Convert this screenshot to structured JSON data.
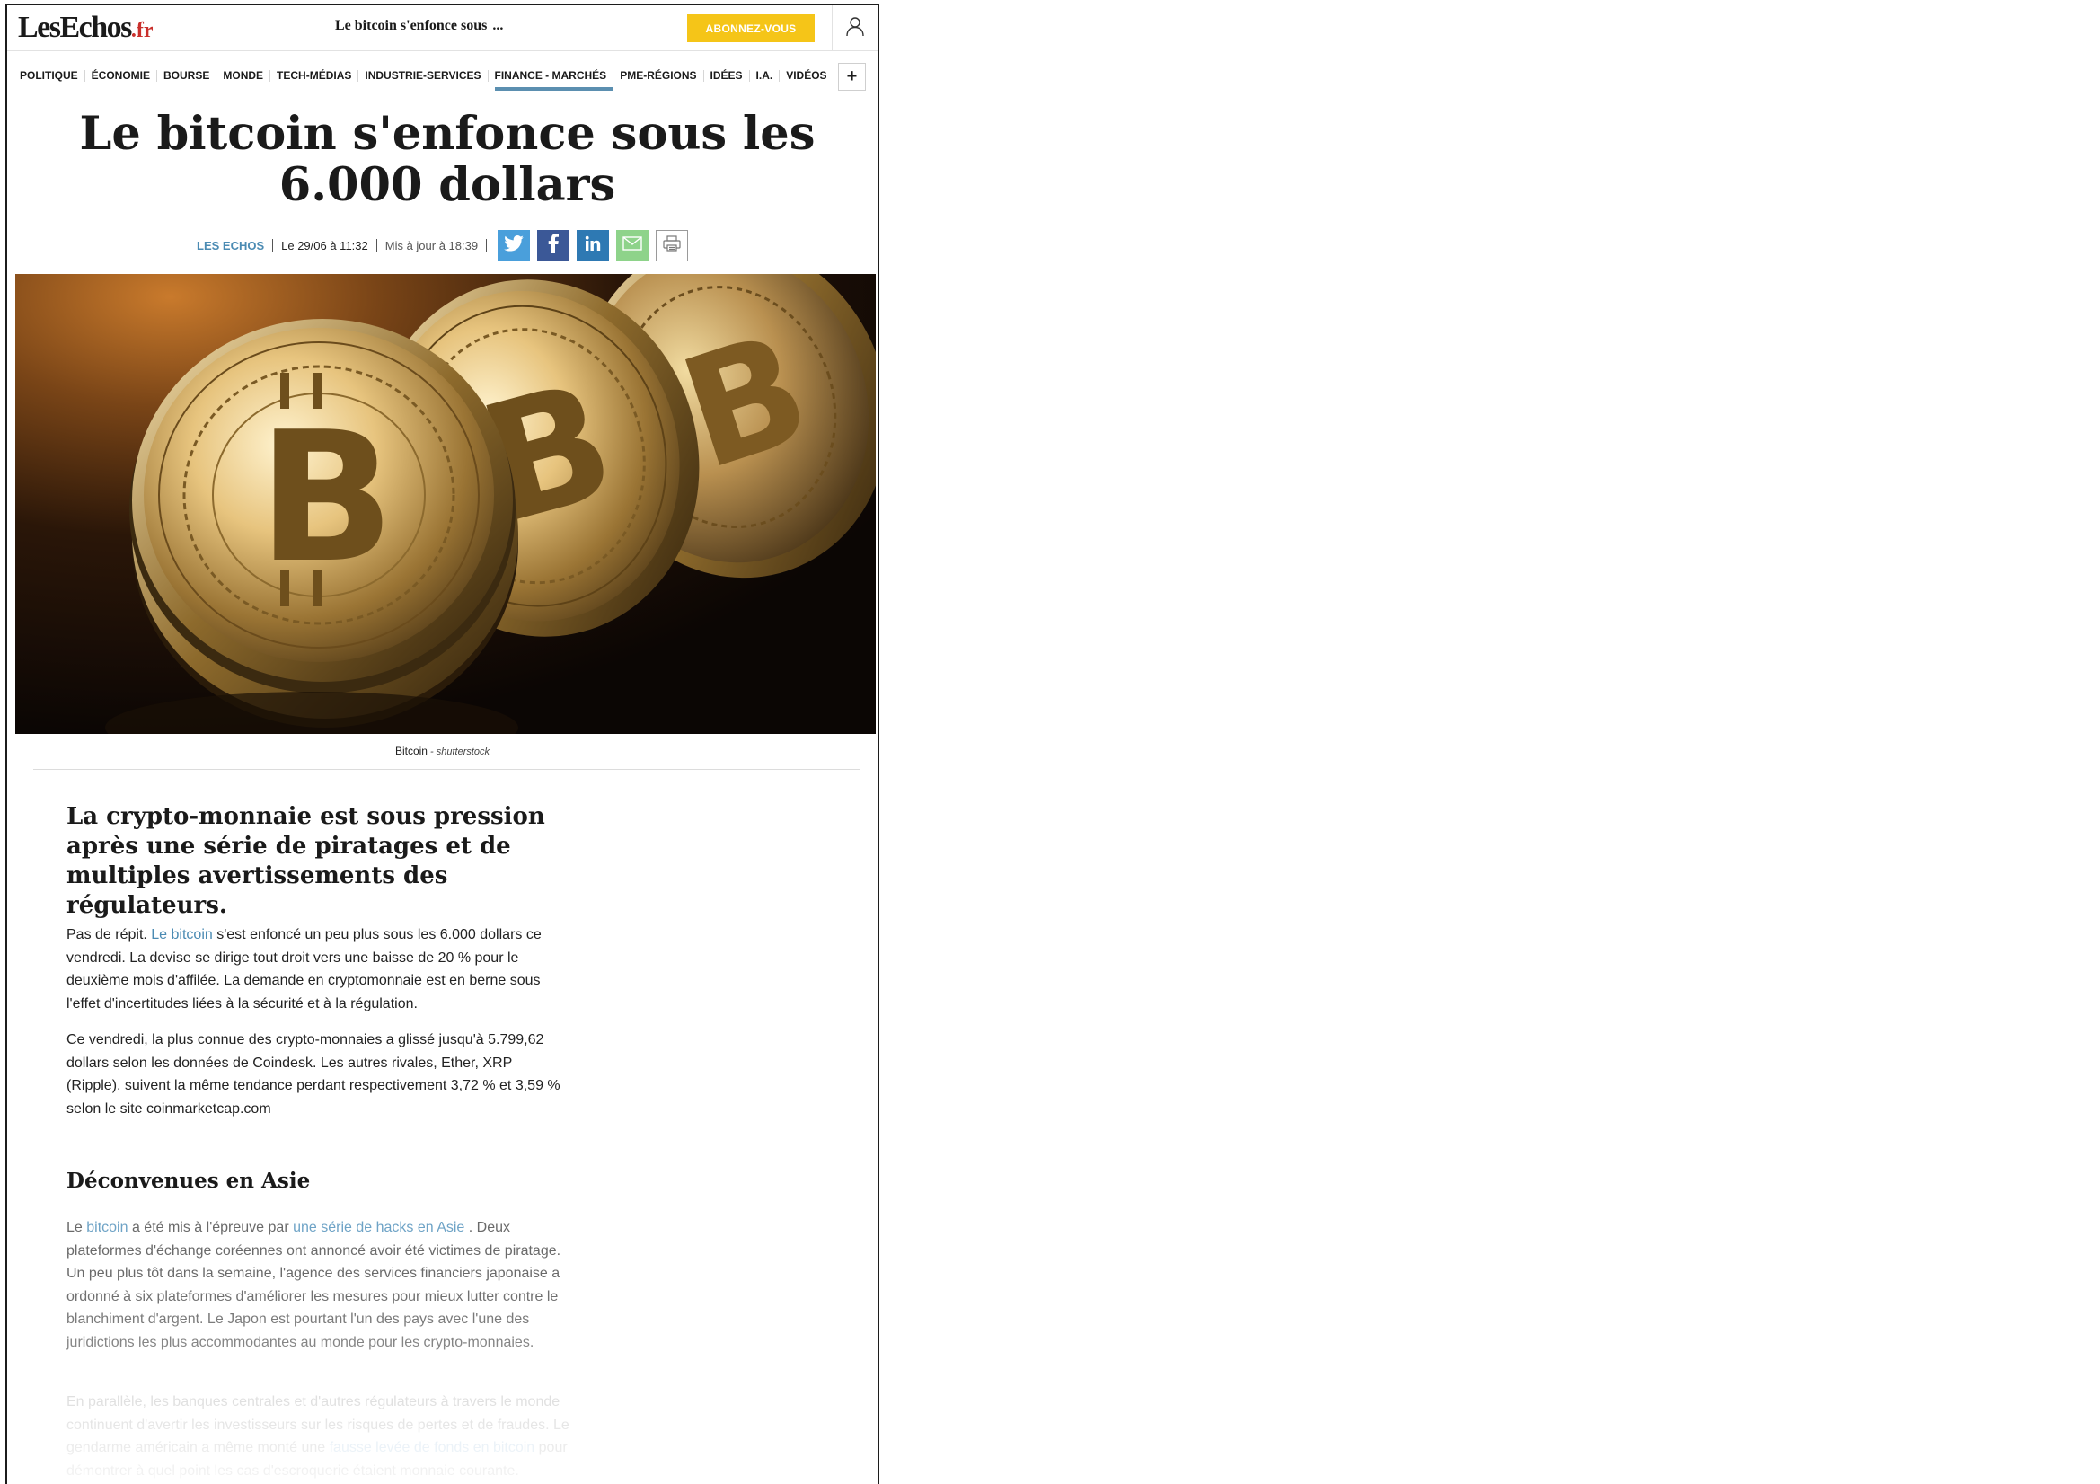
{
  "header": {
    "logo_main": "LesEchos",
    "logo_suffix": ".fr",
    "sticky_title": "Le bitcoin s'enfonce sous",
    "sticky_ellipsis": "...",
    "subscribe_label": "ABONNEZ-VOUS",
    "user_icon": "user-icon"
  },
  "nav": {
    "items": [
      {
        "label": "POLITIQUE"
      },
      {
        "label": "ÉCONOMIE"
      },
      {
        "label": "BOURSE"
      },
      {
        "label": "MONDE"
      },
      {
        "label": "TECH-MÉDIAS"
      },
      {
        "label": "INDUSTRIE-SERVICES"
      },
      {
        "label": "FINANCE - MARCHÉS"
      },
      {
        "label": "PME-RÉGIONS"
      },
      {
        "label": "IDÉES"
      },
      {
        "label": "I.A."
      },
      {
        "label": "VIDÉOS"
      }
    ],
    "active_index": 6,
    "more_label": "+",
    "active_color": "#5b8fb0"
  },
  "article": {
    "title": "Le bitcoin s'enfonce sous les 6.000 dollars",
    "byline": {
      "source": "LES ECHOS",
      "date": "Le 29/06 à 11:32",
      "updated": "Mis à jour à 18:39",
      "share_icons": [
        "twitter-icon",
        "facebook-icon",
        "linkedin-icon",
        "mail-icon",
        "print-icon"
      ]
    },
    "image_caption": "Bitcoin",
    "image_credit": " - shutterstock",
    "lead": "La crypto-monnaie est sous pression après une série de piratages et de multiples avertissements des régulateurs.",
    "p1": {
      "before": "Pas de répit. ",
      "link": "Le bitcoin",
      "after": " s'est enfoncé un peu plus sous les 6.000 dollars ce vendredi. La devise se dirige tout droit vers une baisse de 20 % pour le deuxième mois d'affilée. La demande en cryptomonnaie est en berne sous l'effet d'incertitudes liées à la sécurité et à la régulation."
    },
    "p2": "Ce vendredi, la plus connue des crypto-monnaies a glissé jusqu'à 5.799,62 dollars selon les données de Coindesk. Les autres rivales, Ether, XRP (Ripple), suivent la même tendance perdant respectivement 3,72 % et 3,59 % selon le site coinmarketcap.com",
    "subhead": "Déconvenues en Asie",
    "p3": {
      "t1": "Le ",
      "link1": "bitcoin",
      "t2": " a été mis à l'épreuve par ",
      "link2": "une série de hacks en Asie",
      "t3": " . Deux plateformes d'échange coréennes ont annoncé avoir été victimes de piratage. Un peu plus tôt dans la semaine, l'agence des services financiers japonaise a ordonné à six plateformes d'améliorer les mesures pour mieux lutter contre le blanchiment d'argent. Le Japon est pourtant l'un des pays avec l'une des juridictions les plus accommodantes au monde pour les crypto-monnaies."
    },
    "p4": {
      "t1": "En parallèle, les banques centrales et d'autres régulateurs à travers le monde continuent d'avertir les investisseurs sur les risques de pertes et de fraudes. Le gendarme américain a même monté une ",
      "link": "fausse levée de fonds en bitcoin",
      "t2": " pour démontrer à quel point les cas d'escroquerie étaient monnaie courante."
    }
  },
  "colors": {
    "subscribe": "#f5c518",
    "link": "#4b8bb3",
    "twitter": "#4a9fdb",
    "facebook": "#3b5897",
    "linkedin": "#2e79b3",
    "mail": "#8ed38a"
  }
}
